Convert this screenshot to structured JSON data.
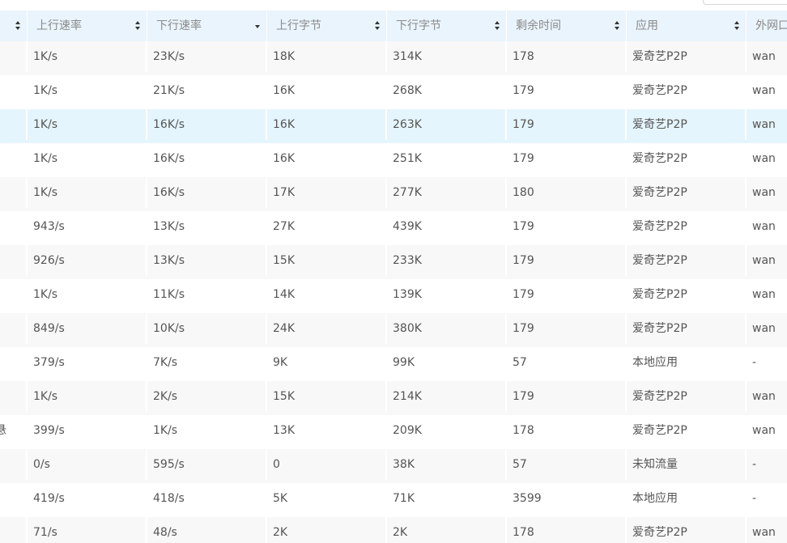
{
  "table": {
    "columns": [
      {
        "label": "",
        "sort": "both"
      },
      {
        "label": "上行速率",
        "sort": "both"
      },
      {
        "label": "下行速率",
        "sort": "desc"
      },
      {
        "label": "上行字节",
        "sort": "both"
      },
      {
        "label": "下行字节",
        "sort": "both"
      },
      {
        "label": "剩余时间",
        "sort": "both"
      },
      {
        "label": "应用",
        "sort": "both"
      },
      {
        "label": "外网口",
        "sort": "none"
      }
    ],
    "rows": [
      {
        "cells": [
          "",
          "1K/s",
          "23K/s",
          "18K",
          "314K",
          "178",
          "爱奇艺P2P",
          "wan"
        ]
      },
      {
        "cells": [
          "",
          "1K/s",
          "21K/s",
          "16K",
          "268K",
          "179",
          "爱奇艺P2P",
          "wan"
        ]
      },
      {
        "cells": [
          "",
          "1K/s",
          "16K/s",
          "16K",
          "263K",
          "179",
          "爱奇艺P2P",
          "wan"
        ],
        "selected": true
      },
      {
        "cells": [
          "",
          "1K/s",
          "16K/s",
          "16K",
          "251K",
          "179",
          "爱奇艺P2P",
          "wan"
        ]
      },
      {
        "cells": [
          "",
          "1K/s",
          "16K/s",
          "17K",
          "277K",
          "180",
          "爱奇艺P2P",
          "wan"
        ]
      },
      {
        "cells": [
          "",
          "943/s",
          "13K/s",
          "27K",
          "439K",
          "179",
          "爱奇艺P2P",
          "wan"
        ]
      },
      {
        "cells": [
          "",
          "926/s",
          "13K/s",
          "15K",
          "233K",
          "179",
          "爱奇艺P2P",
          "wan"
        ]
      },
      {
        "cells": [
          "",
          "1K/s",
          "11K/s",
          "14K",
          "139K",
          "179",
          "爱奇艺P2P",
          "wan"
        ]
      },
      {
        "cells": [
          "",
          "849/s",
          "10K/s",
          "24K",
          "380K",
          "179",
          "爱奇艺P2P",
          "wan"
        ]
      },
      {
        "cells": [
          "",
          "379/s",
          "7K/s",
          "9K",
          "99K",
          "57",
          "本地应用",
          "-"
        ]
      },
      {
        "cells": [
          "",
          "1K/s",
          "2K/s",
          "15K",
          "214K",
          "179",
          "爱奇艺P2P",
          "wan"
        ]
      },
      {
        "cells": [
          "悬",
          "399/s",
          "1K/s",
          "13K",
          "209K",
          "178",
          "爱奇艺P2P",
          "wan"
        ]
      },
      {
        "cells": [
          "",
          "0/s",
          "595/s",
          "0",
          "38K",
          "57",
          "未知流量",
          "-"
        ]
      },
      {
        "cells": [
          "",
          "419/s",
          "418/s",
          "5K",
          "71K",
          "3599",
          "本地应用",
          "-"
        ]
      },
      {
        "cells": [
          "",
          "71/s",
          "48/s",
          "2K",
          "2K",
          "178",
          "爱奇艺P2P",
          "wan"
        ]
      }
    ]
  },
  "colors": {
    "header_bg": "#e9f4fc",
    "row_alt_bg": "#f8f8f8",
    "row_selected_bg": "#e5f5fd",
    "text": "#555555",
    "header_text": "#8a8a8a"
  }
}
